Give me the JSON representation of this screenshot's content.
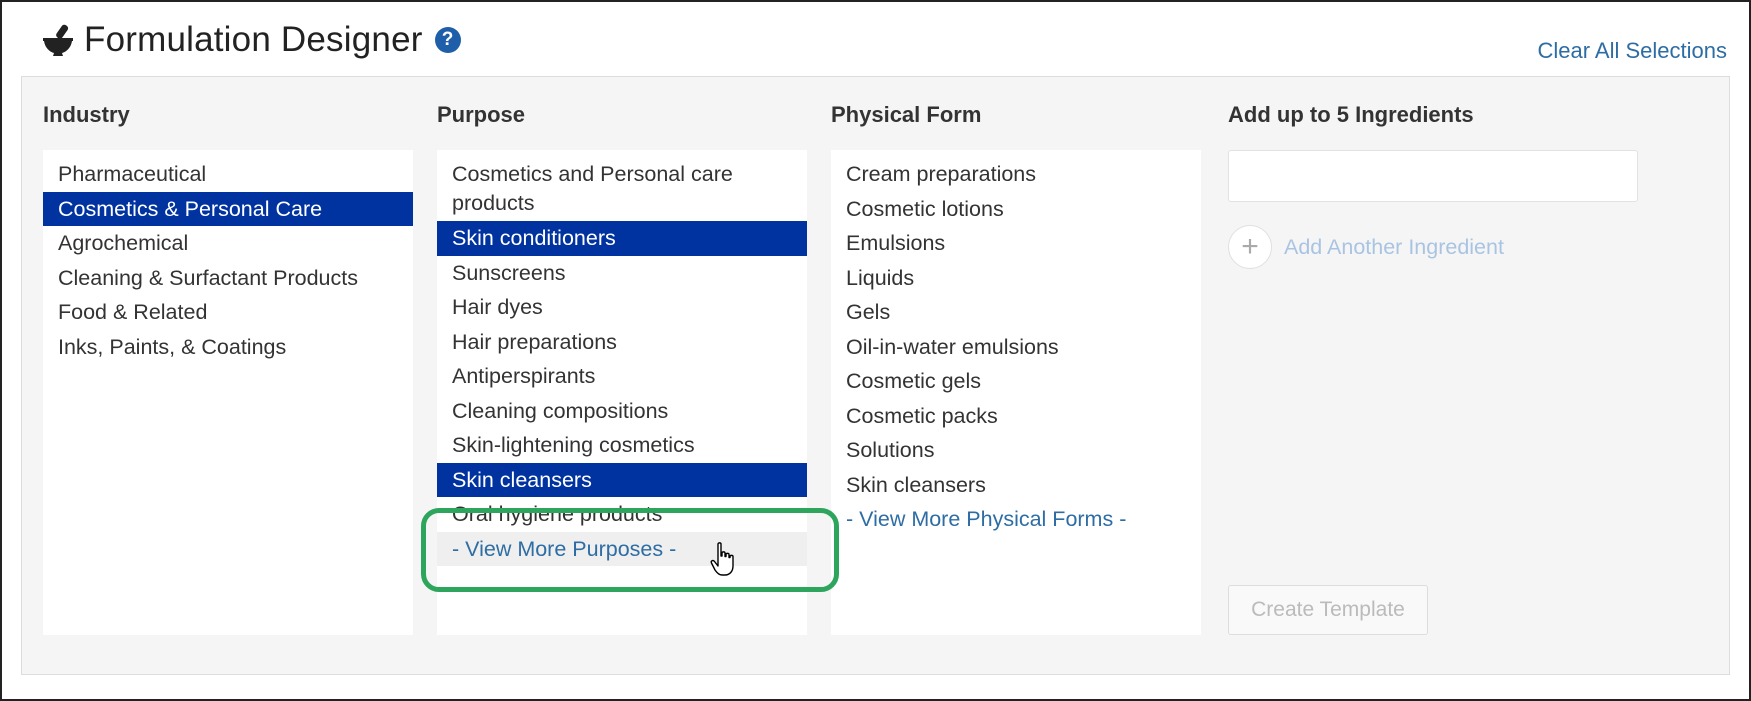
{
  "header": {
    "title": "Formulation Designer",
    "help_glyph": "?",
    "clear_all": "Clear All Selections"
  },
  "industry": {
    "title": "Industry",
    "items": [
      {
        "label": "Pharmaceutical",
        "selected": false
      },
      {
        "label": "Cosmetics & Personal Care",
        "selected": true
      },
      {
        "label": "Agrochemical",
        "selected": false
      },
      {
        "label": "Cleaning & Surfactant Products",
        "selected": false
      },
      {
        "label": "Food & Related",
        "selected": false
      },
      {
        "label": "Inks, Paints, & Coatings",
        "selected": false
      }
    ]
  },
  "purpose": {
    "title": "Purpose",
    "items": [
      {
        "label": "Cosmetics and Personal care products",
        "selected": false
      },
      {
        "label": "Skin conditioners",
        "selected": true
      },
      {
        "label": "Sunscreens",
        "selected": false
      },
      {
        "label": "Hair dyes",
        "selected": false
      },
      {
        "label": "Hair preparations",
        "selected": false
      },
      {
        "label": "Antiperspirants",
        "selected": false
      },
      {
        "label": "Cleaning compositions",
        "selected": false
      },
      {
        "label": "Skin-lightening cosmetics",
        "selected": false
      },
      {
        "label": "Skin cleansers",
        "selected": true
      },
      {
        "label": "Oral hygiene products",
        "selected": false
      }
    ],
    "view_more": "- View More Purposes -"
  },
  "physical_form": {
    "title": "Physical Form",
    "items": [
      {
        "label": "Cream preparations",
        "selected": false
      },
      {
        "label": "Cosmetic lotions",
        "selected": false
      },
      {
        "label": "Emulsions",
        "selected": false
      },
      {
        "label": "Liquids",
        "selected": false
      },
      {
        "label": "Gels",
        "selected": false
      },
      {
        "label": "Oil-in-water emulsions",
        "selected": false
      },
      {
        "label": "Cosmetic gels",
        "selected": false
      },
      {
        "label": "Cosmetic packs",
        "selected": false
      },
      {
        "label": "Solutions",
        "selected": false
      },
      {
        "label": "Skin cleansers",
        "selected": false
      }
    ],
    "view_more": "- View More Physical Forms -"
  },
  "ingredients": {
    "title": "Add up to 5 Ingredients",
    "input_value": "",
    "add_another": "Add Another Ingredient",
    "create_template": "Create Template"
  },
  "colors": {
    "selected_bg": "#0033a0",
    "link": "#2e6da4",
    "highlight": "#2ea55c"
  },
  "icons": {
    "title_icon": "mortar-pestle-icon",
    "help": "help-icon",
    "add": "plus-icon",
    "cursor": "hand-cursor-icon"
  }
}
